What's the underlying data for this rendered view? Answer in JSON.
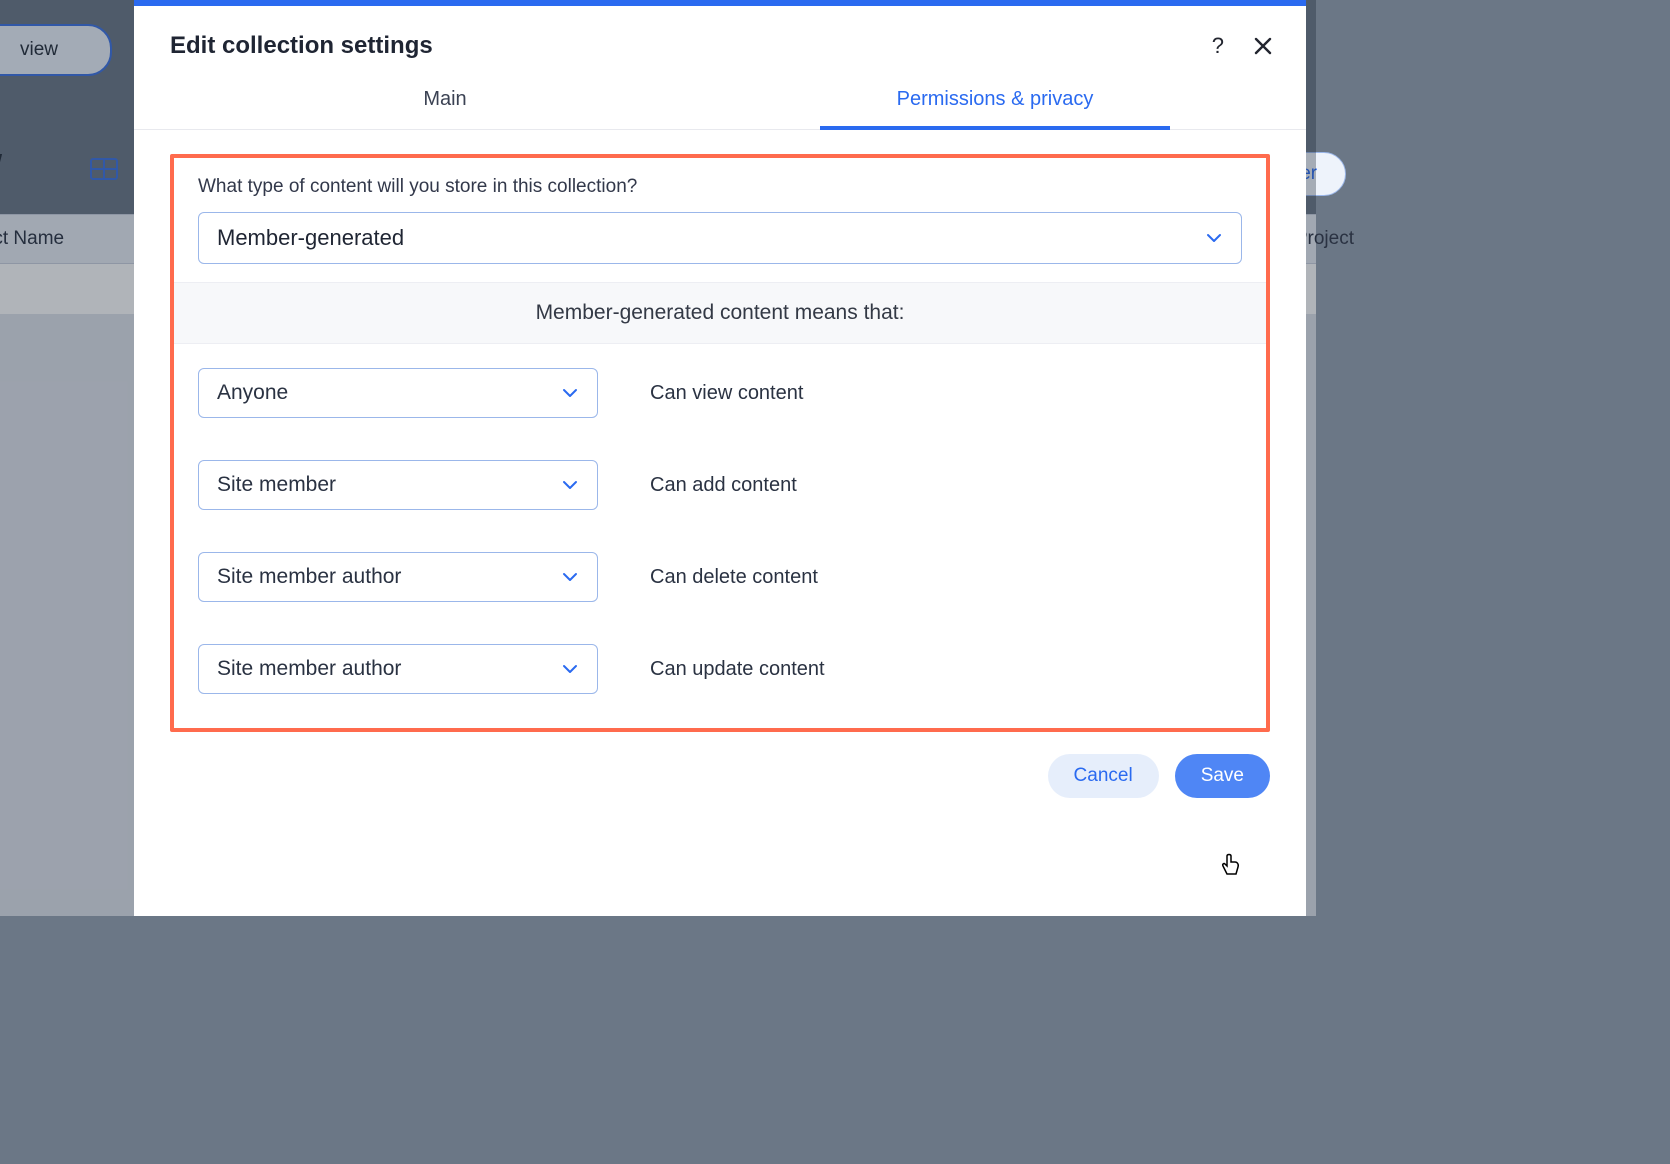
{
  "background": {
    "view_pill": "view",
    "view_label": "view",
    "filter_label": "Filter",
    "col_left": "oject Name",
    "col_right": "# Project"
  },
  "modal": {
    "title": "Edit collection settings",
    "tabs": {
      "main": "Main",
      "permissions": "Permissions & privacy"
    },
    "question": "What type of content will you store in this collection?",
    "content_type_value": "Member-generated",
    "explain": "Member-generated content means that:",
    "permissions": [
      {
        "value": "Anyone",
        "label": "Can view content"
      },
      {
        "value": "Site member",
        "label": "Can add content"
      },
      {
        "value": "Site member author",
        "label": "Can delete content"
      },
      {
        "value": "Site member author",
        "label": "Can update content"
      }
    ],
    "buttons": {
      "cancel": "Cancel",
      "save": "Save"
    }
  }
}
